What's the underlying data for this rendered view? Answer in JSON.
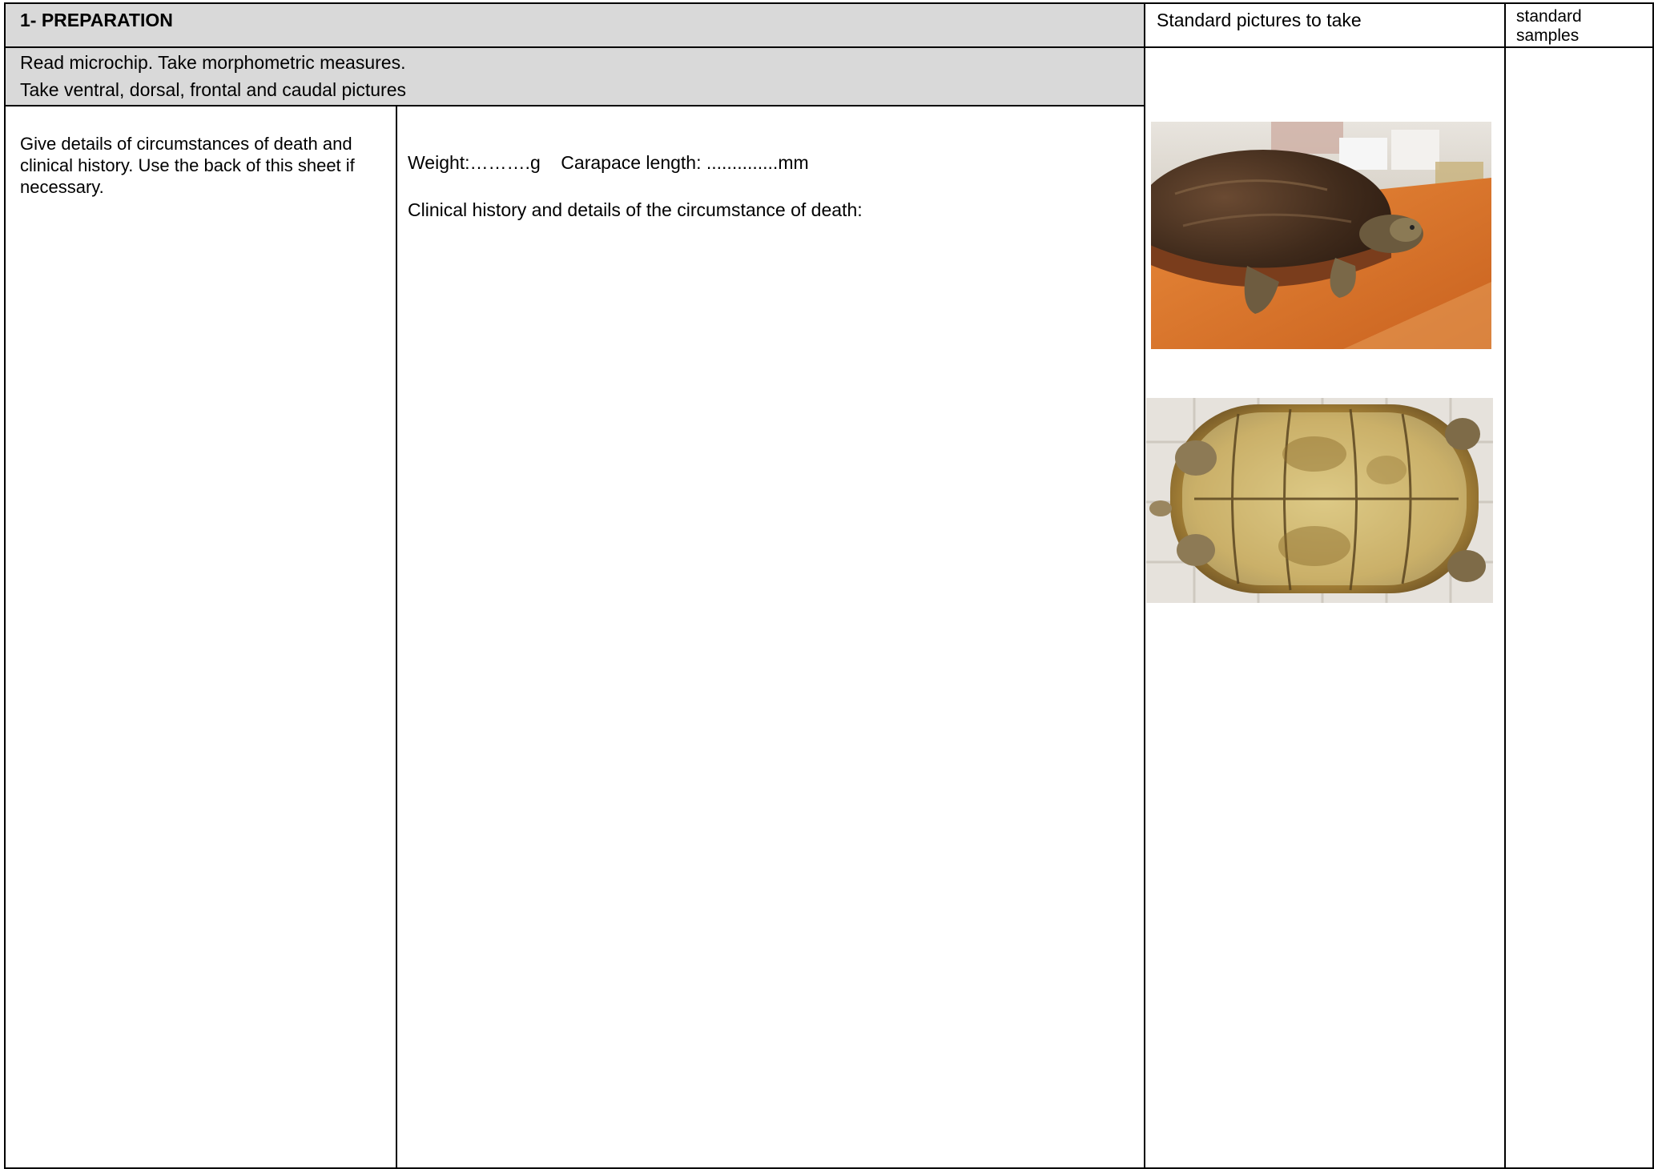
{
  "header": {
    "section_title": "1- PREPARATION",
    "pictures_header": "Standard pictures to take",
    "samples_header_line1": "standard",
    "samples_header_line2": "samples"
  },
  "instructions": {
    "line1": "Read microchip. Take morphometric measures.",
    "line2": "Take ventral, dorsal, frontal and caudal pictures"
  },
  "left_column": {
    "text": "Give details of circumstances of death and clinical history. Use the back of this sheet if necessary."
  },
  "form": {
    "weight_line": "Weight:……….g    Carapace length: ..............mm",
    "history_label": "Clinical history and details of the circumstance of death:"
  },
  "colors": {
    "header_gray": "#d9d9d9",
    "border": "#000000",
    "orange_board": "#e07a2a",
    "tortoise_shell": "#c9a050"
  },
  "pictures": [
    {
      "name": "tortoise-dorsal-photo"
    },
    {
      "name": "tortoise-ventral-photo"
    }
  ]
}
